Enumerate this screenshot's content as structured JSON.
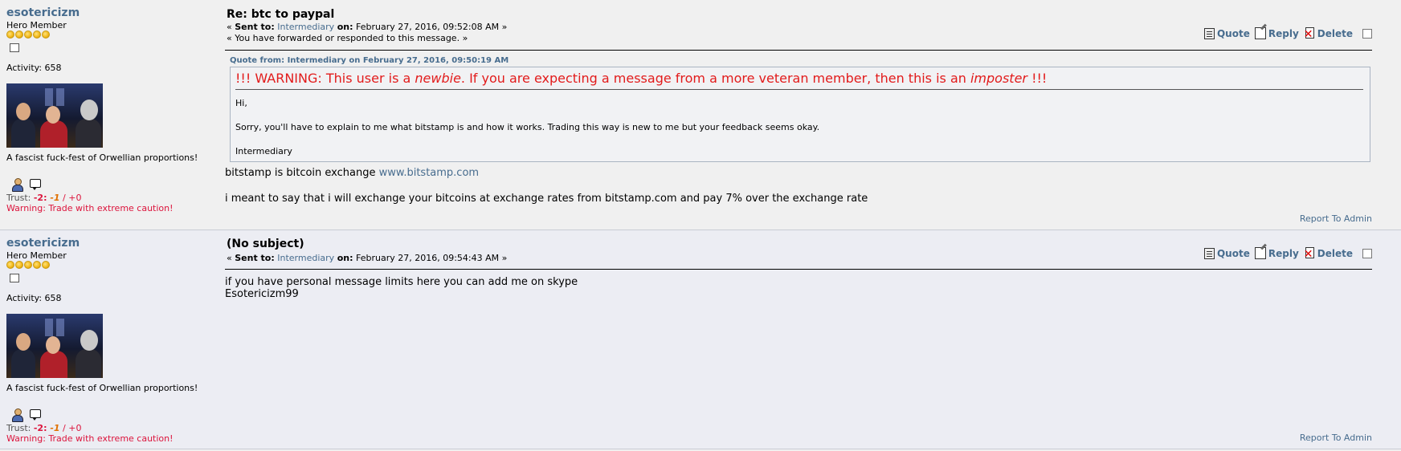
{
  "posts": [
    {
      "poster": {
        "name": "esotericizm",
        "rank": "Hero Member",
        "activity": "Activity: 658",
        "signature": "A fascist fuck-fest of Orwellian proportions!",
        "trust_label": "Trust: ",
        "trust_neg": "-2",
        "trust_colon": ": ",
        "trust_negi": "-1",
        "trust_sep": " / ",
        "trust_pos": "+0",
        "warning": "Warning: Trade with extreme caution!"
      },
      "subject": "Re: btc to paypal",
      "meta_open": "« ",
      "sent_to_label": "Sent to:",
      "sent_to": "Intermediary",
      "on_label": "on:",
      "date": "February 27, 2016, 09:52:08 AM",
      "meta_close": " »",
      "forwarded": "« You have forwarded or responded to this message. »",
      "actions": {
        "quote": "Quote",
        "reply": "Reply",
        "delete": "Delete"
      },
      "quote": {
        "header": "Quote from: Intermediary on February 27, 2016, 09:50:19 AM",
        "warning_a": "!!! WARNING: This user is a ",
        "warning_b": "newbie",
        "warning_c": ". If you are expecting a message from a more veteran member, then this is an ",
        "warning_d": "imposter",
        "warning_e": " !!!",
        "line1": "Hi,",
        "line2": "Sorry, you'll have to explain to me what bitstamp is and how it works. Trading this way is new to me but your feedback seems okay.",
        "line3": "Intermediary"
      },
      "body_line1": "bitstamp is bitcoin exchange ",
      "body_link": "www.bitstamp.com",
      "body_line2": "i meant to say that i will exchange your bitcoins at exchange rates from bitstamp.com and pay 7% over the exchange rate",
      "report": "Report To Admin"
    },
    {
      "poster": {
        "name": "esotericizm",
        "rank": "Hero Member",
        "activity": "Activity: 658",
        "signature": "A fascist fuck-fest of Orwellian proportions!",
        "trust_label": "Trust: ",
        "trust_neg": "-2",
        "trust_colon": ": ",
        "trust_negi": "-1",
        "trust_sep": " / ",
        "trust_pos": "+0",
        "warning": "Warning: Trade with extreme caution!"
      },
      "subject": "(No subject)",
      "meta_open": "« ",
      "sent_to_label": "Sent to:",
      "sent_to": "Intermediary",
      "on_label": "on:",
      "date": "February 27, 2016, 09:54:43 AM",
      "meta_close": " »",
      "actions": {
        "quote": "Quote",
        "reply": "Reply",
        "delete": "Delete"
      },
      "body_line1": "if you have personal message limits here you can add me on skype",
      "body_line2": "Esotericizm99",
      "report": "Report To Admin"
    }
  ],
  "colors": {
    "link": "#476c8e",
    "warning_red": "#e21b1b",
    "trust_red": "#dc143c"
  }
}
